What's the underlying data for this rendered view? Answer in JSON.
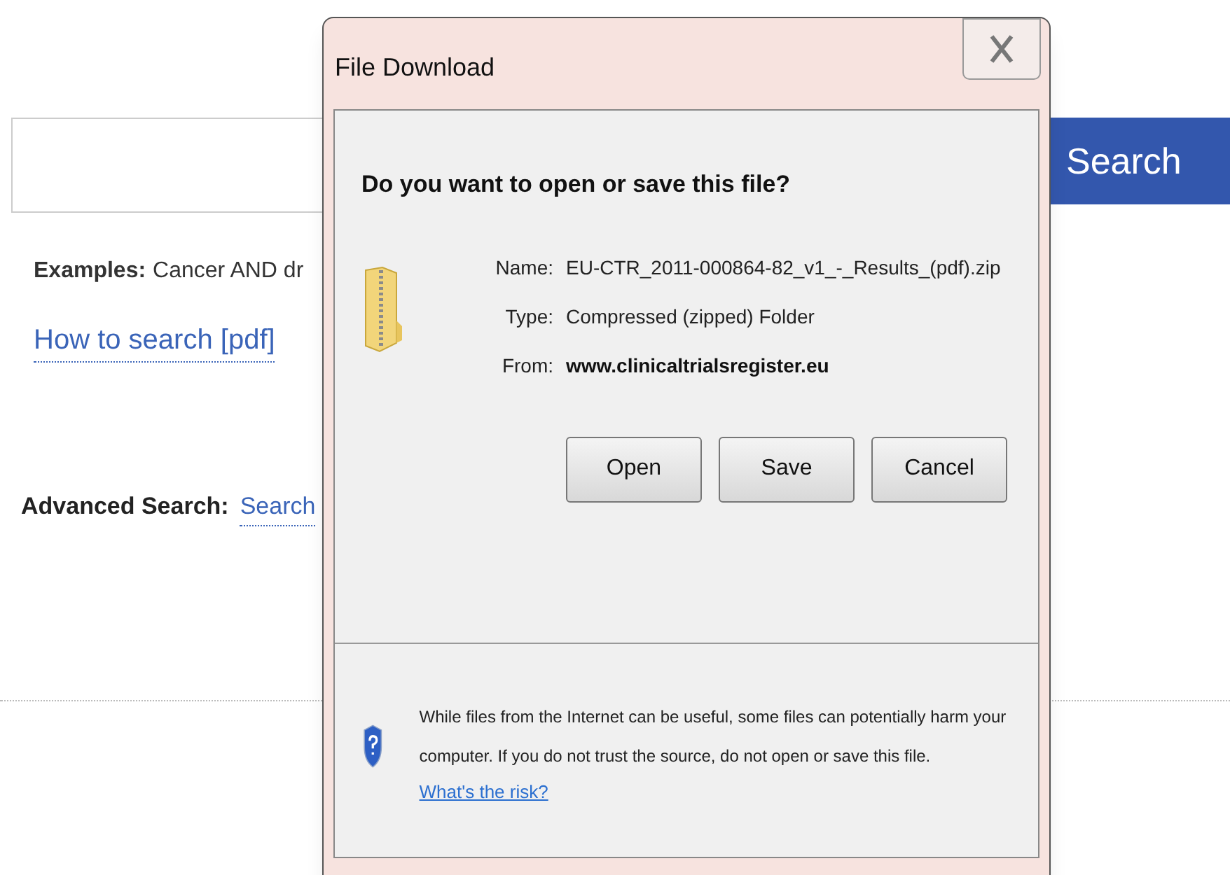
{
  "page": {
    "search_button": "Search",
    "examples_label": "Examples:",
    "examples_text": "Cancer AND dr",
    "how_to_link": "How to search [pdf]",
    "advanced_label": "Advanced Search:",
    "advanced_link": "Search"
  },
  "dialog": {
    "title": "File Download",
    "question": "Do you want to open or save this file?",
    "fields": [
      {
        "label": "Name:",
        "value": "EU-CTR_2011-000864-82_v1_-_Results_(pdf).zip",
        "bold": false
      },
      {
        "label": "Type:",
        "value": "Compressed (zipped) Folder",
        "bold": false
      },
      {
        "label": "From:",
        "value": "www.clinicaltrialsregister.eu",
        "bold": true
      }
    ],
    "buttons": [
      "Open",
      "Save",
      "Cancel"
    ],
    "warning": "While files from the Internet can be useful, some files can potentially harm your computer. If you do not trust the source, do not open or save this file.",
    "risk_link": "What's the risk?"
  }
}
